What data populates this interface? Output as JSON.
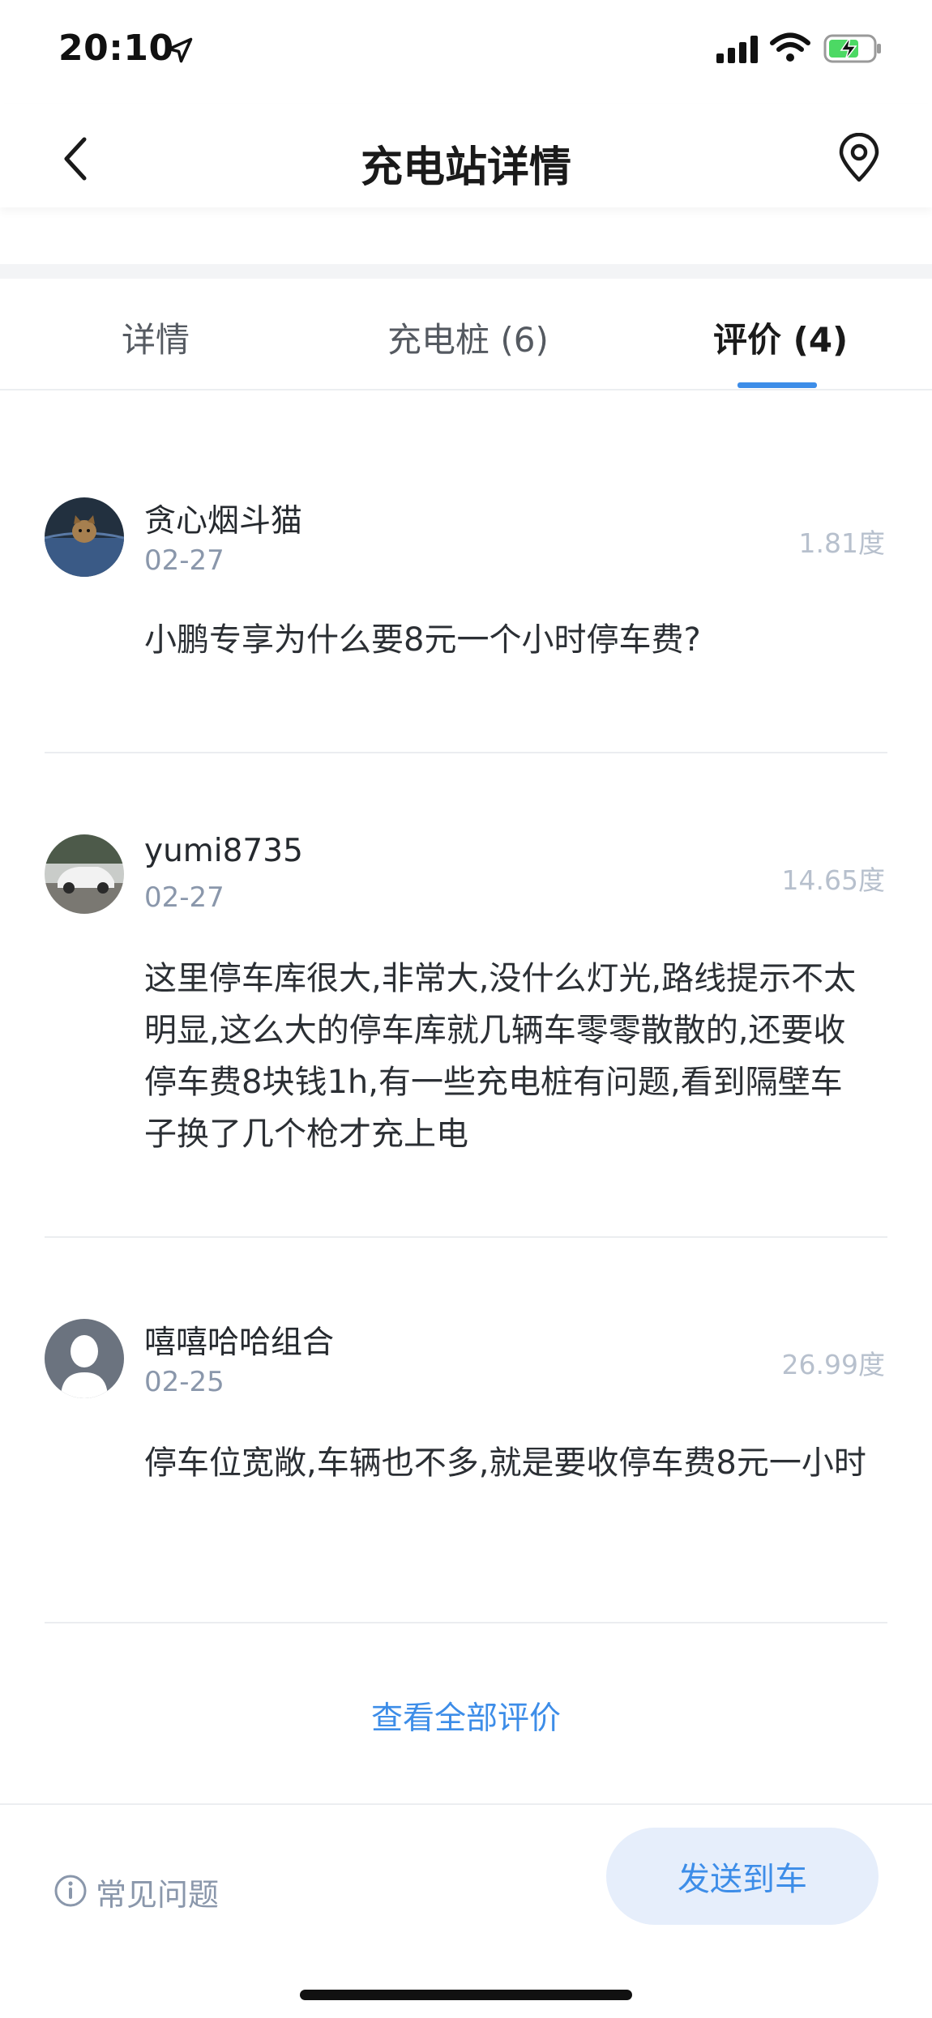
{
  "status_bar": {
    "time": "20:10",
    "icons": [
      "location-arrow-icon",
      "cellular-signal-icon",
      "wifi-icon",
      "battery-charging-icon"
    ]
  },
  "nav": {
    "title": "充电站详情",
    "back_icon": "chevron-left-icon",
    "location_icon": "location-pin-icon"
  },
  "tabs": [
    {
      "label": "详情",
      "active": false
    },
    {
      "label": "充电桩 (6)",
      "active": false
    },
    {
      "label": "评价 (4)",
      "active": true
    }
  ],
  "reviews": [
    {
      "name": "贪心烟斗猫",
      "date": "02-27",
      "metric": "1.81度",
      "text": "小鹏专享为什么要8元一个小时停车费?"
    },
    {
      "name": "yumi8735",
      "date": "02-27",
      "metric": "14.65度",
      "text": "这里停车库很大,非常大,没什么灯光,路线提示不太明显,这么大的停车库就几辆车零零散散的,还要收停车费8块钱1h,有一些充电桩有问题,看到隔壁车子换了几个枪才充上电"
    },
    {
      "name": "嘻嘻哈哈组合",
      "date": "02-25",
      "metric": "26.99度",
      "text": "停车位宽敞,车辆也不多,就是要收停车费8元一小时"
    }
  ],
  "view_all": "查看全部评价",
  "bottom": {
    "faq_label": "常见问题",
    "faq_icon": "info-circle-icon",
    "send_button": "发送到车"
  },
  "colors": {
    "accent": "#3d8de8",
    "button_bg": "#e6eefb",
    "muted": "#8a97ab"
  }
}
